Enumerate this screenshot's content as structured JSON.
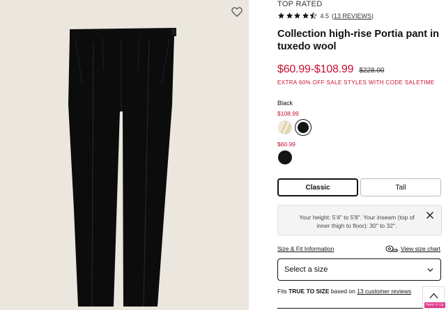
{
  "product": {
    "badge": "TOP RATED",
    "rating": {
      "value": "4.5",
      "stars": 4.5,
      "reviews_link": "13 REVIEWS"
    },
    "title": "Collection high-rise Portia pant in tuxedo wool",
    "price": "$60.99-$108.99",
    "original_price": "$228.00",
    "promo": "EXTRA 60% OFF SALE STYLES WITH CODE SALETIME"
  },
  "colors": {
    "selected_name": "Black",
    "tiers": [
      {
        "price": "$108.99",
        "swatches": [
          "cream-gold",
          "black"
        ]
      },
      {
        "price": "$60.99",
        "swatches": [
          "black"
        ]
      }
    ]
  },
  "fit": {
    "options": [
      "Classic",
      "Tall"
    ],
    "selected": "Classic"
  },
  "fit_tip": {
    "text": "Your height: 5'4\" to 5'8\". Your inseam (top of inner thigh to floor): 30\" to 32\"."
  },
  "size": {
    "info_link": "Size & Fit Information",
    "chart_link": "View size chart",
    "placeholder": "Select a size"
  },
  "fit_summary": {
    "prefix": "Fits",
    "emphasis": "TRUE TO SIZE",
    "middle": "based on",
    "link": "13 customer reviews"
  },
  "overlay": {
    "badge": "Paint it Up"
  },
  "colors_hex": {
    "sale_red": "#c8102e",
    "photo_bg": "#ebe6de",
    "text": "#111111"
  },
  "icons": {
    "favorite": "heart-icon",
    "close": "close-icon",
    "size_chart": "measuring-tape-icon",
    "dropdown": "chevron-down-icon",
    "scroll_top": "chevron-up-icon"
  }
}
